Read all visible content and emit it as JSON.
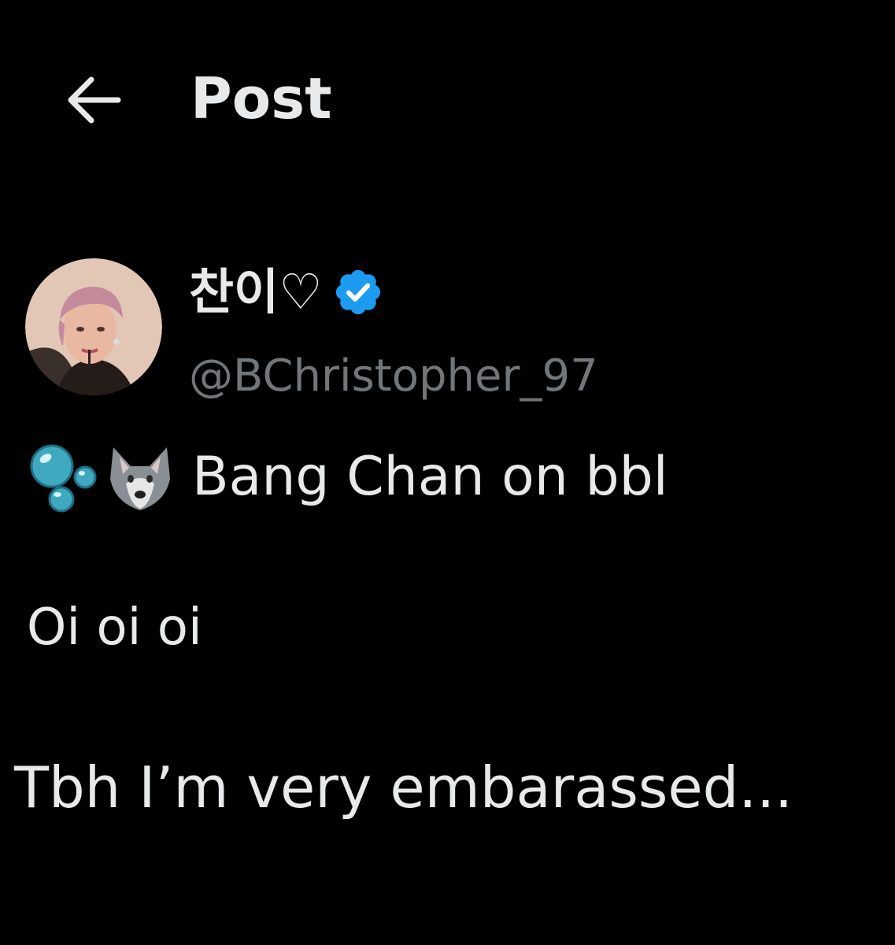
{
  "header": {
    "back_icon": "arrow-left-icon",
    "title": "Post"
  },
  "author": {
    "display_name": "찬이♡",
    "verified_icon": "verified-badge-icon",
    "verified_color": "#1d9bf0",
    "handle": "@BChristopher_97"
  },
  "tweet": {
    "emojis": [
      "bubbles-icon",
      "wolf-icon"
    ],
    "lines": [
      "Bang Chan on bbl",
      "Oi oi oi",
      "Tbh I’m very embarassed..."
    ]
  },
  "colors": {
    "background": "#000000",
    "primary_text": "#e7e9ea",
    "secondary_text": "#71767b"
  }
}
